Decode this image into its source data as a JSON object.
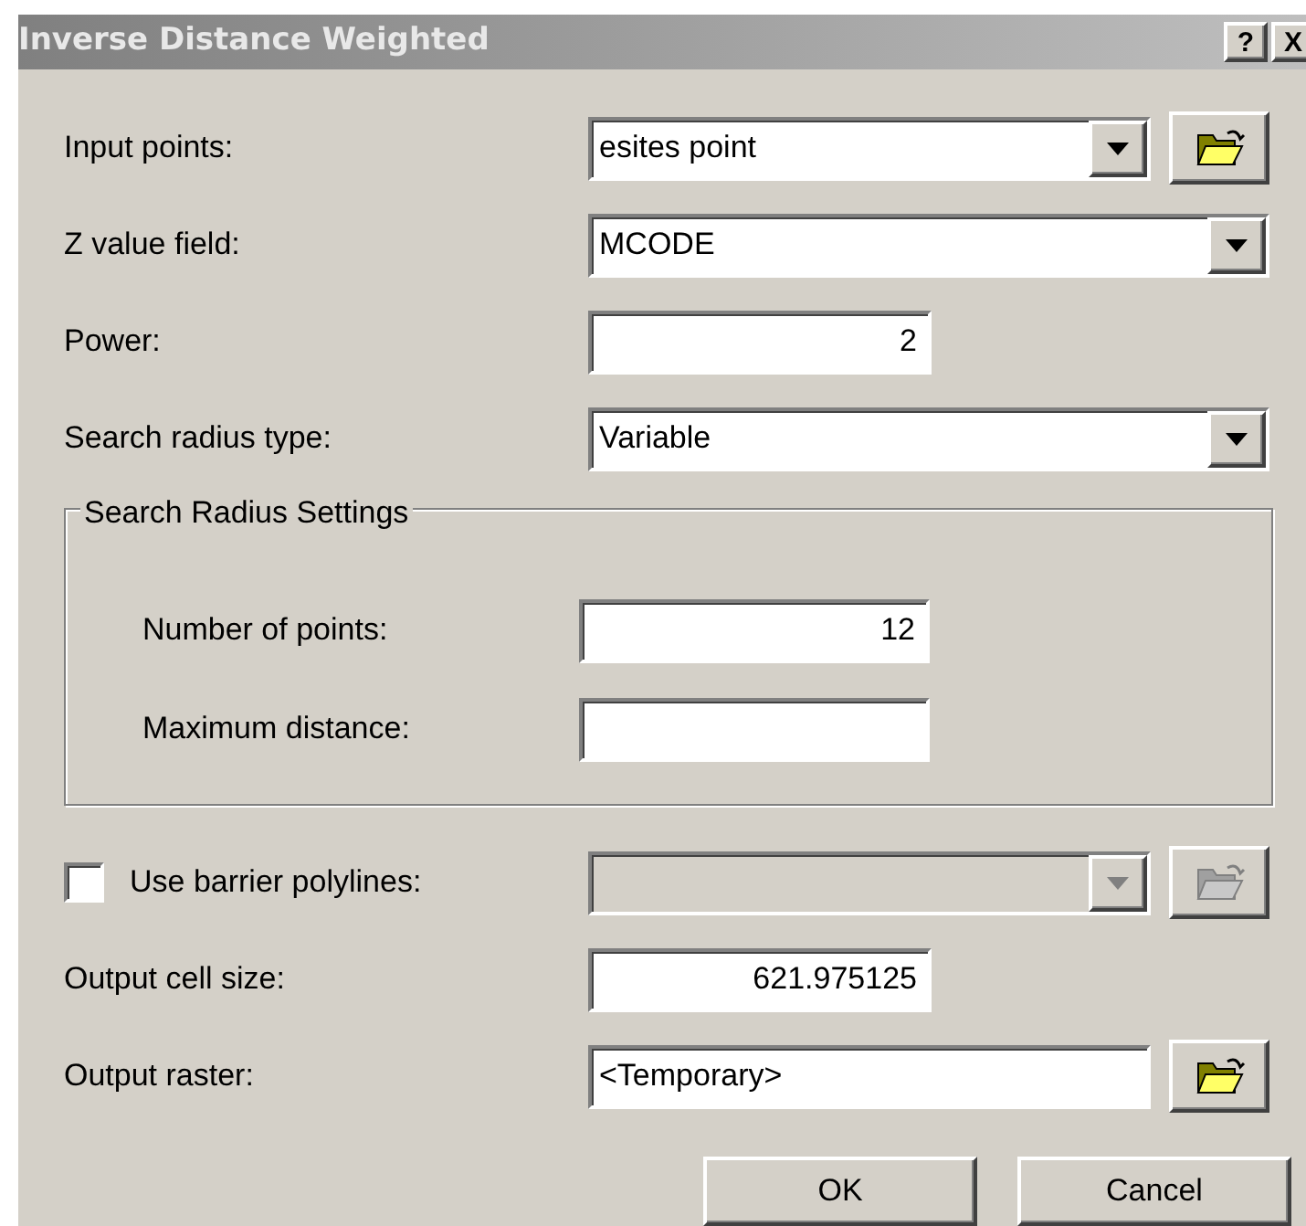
{
  "window": {
    "title": "Inverse Distance Weighted",
    "buttons": [
      "?",
      "X"
    ]
  },
  "fields": [
    {
      "kind": "combo",
      "label": "Input points:",
      "value": "esites point",
      "browse": true
    },
    {
      "kind": "combo",
      "label": "Z value field:",
      "value": "MCODE",
      "browse": false
    },
    {
      "kind": "number",
      "label": "Power:",
      "value": "2"
    },
    {
      "kind": "combo",
      "label": "Search radius type:",
      "value": "Variable",
      "browse": false
    }
  ],
  "search_radius_settings": {
    "title": "Search Radius Settings",
    "fields": [
      {
        "label": "Number of points:",
        "value": "12"
      },
      {
        "label": "Maximum distance:"
      }
    ]
  },
  "barrier": {
    "label": "Use barrier polylines:",
    "checked": false,
    "disabled": true
  },
  "output": [
    {
      "kind": "number",
      "label": "Output cell size:",
      "value": "621.975125"
    },
    {
      "kind": "text",
      "label": "Output raster:",
      "value": "<Temporary>",
      "browse": true
    }
  ],
  "buttons": [
    "OK",
    "Cancel"
  ]
}
